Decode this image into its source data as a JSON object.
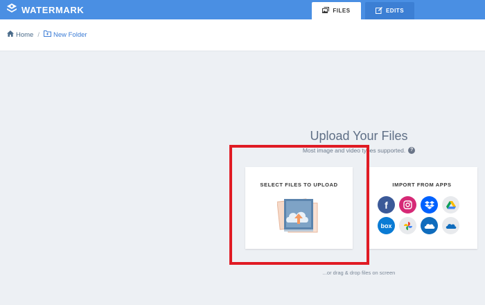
{
  "brand": {
    "name": "WATERMARK"
  },
  "tabs": [
    {
      "label": "FILES",
      "active": true
    },
    {
      "label": "EDITS",
      "active": false
    }
  ],
  "breadcrumb": {
    "home": "Home",
    "separator": "/",
    "folder": "New Folder"
  },
  "upload": {
    "title": "Upload Your Files",
    "subtitle": "Most image and video types supported.",
    "select_card_title": "SELECT FILES TO UPLOAD",
    "import_card_title": "IMPORT FROM APPS",
    "apps": [
      {
        "name": "facebook-icon",
        "glyph": "f",
        "bg": "#3b5998"
      },
      {
        "name": "instagram-icon",
        "glyph": "",
        "bg": "#d62976"
      },
      {
        "name": "dropbox-icon",
        "glyph": "",
        "bg": "#0061fe"
      },
      {
        "name": "google-drive-icon",
        "glyph": "",
        "bg": "#e8eaed"
      },
      {
        "name": "box-icon",
        "glyph": "box",
        "bg": "#0a7bd4"
      },
      {
        "name": "google-photos-icon",
        "glyph": "",
        "bg": "#e8eaed"
      },
      {
        "name": "onedrive-icon",
        "glyph": "",
        "bg": "#0f6cbd"
      },
      {
        "name": "onedrive-personal-icon",
        "glyph": "",
        "bg": "#e8eaed"
      }
    ],
    "drag_hint": "...or drag & drop files on screen"
  },
  "colors": {
    "topbar": "#4a8fe3",
    "highlight": "#e01b24",
    "background": "#edf0f4"
  }
}
